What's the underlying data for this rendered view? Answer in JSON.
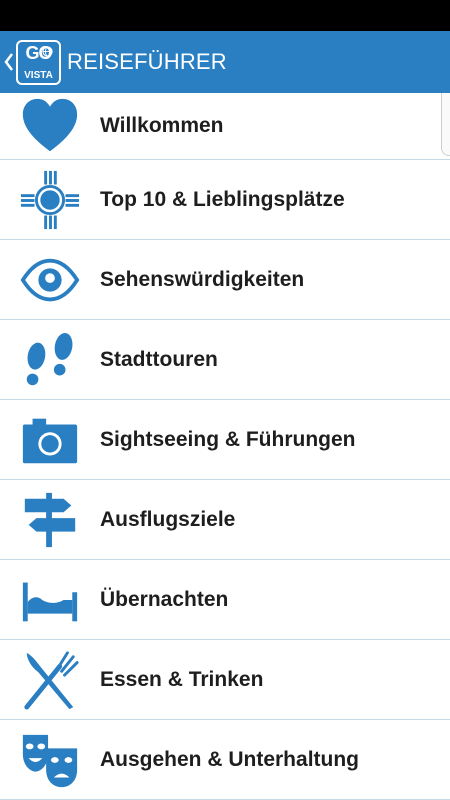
{
  "header": {
    "logo_top": "GO",
    "logo_bottom": "VISTA",
    "title": "REISEFÜHRER"
  },
  "colors": {
    "accent": "#2a7fc3",
    "icon": "#2a7fc3",
    "divider": "#c6d9e6"
  },
  "menu": [
    {
      "icon": "heart-icon",
      "label": "Willkommen"
    },
    {
      "icon": "sun-symbol-icon",
      "label": "Top 10 & Lieblingsplätze"
    },
    {
      "icon": "eye-icon",
      "label": "Sehenswürdigkeiten"
    },
    {
      "icon": "footprints-icon",
      "label": "Stadttouren"
    },
    {
      "icon": "camera-icon",
      "label": "Sightseeing & Führungen"
    },
    {
      "icon": "signpost-icon",
      "label": "Ausflugsziele"
    },
    {
      "icon": "bed-icon",
      "label": "Übernachten"
    },
    {
      "icon": "fork-knife-icon",
      "label": "Essen & Trinken"
    },
    {
      "icon": "theater-masks-icon",
      "label": "Ausgehen & Unterhaltung"
    }
  ]
}
